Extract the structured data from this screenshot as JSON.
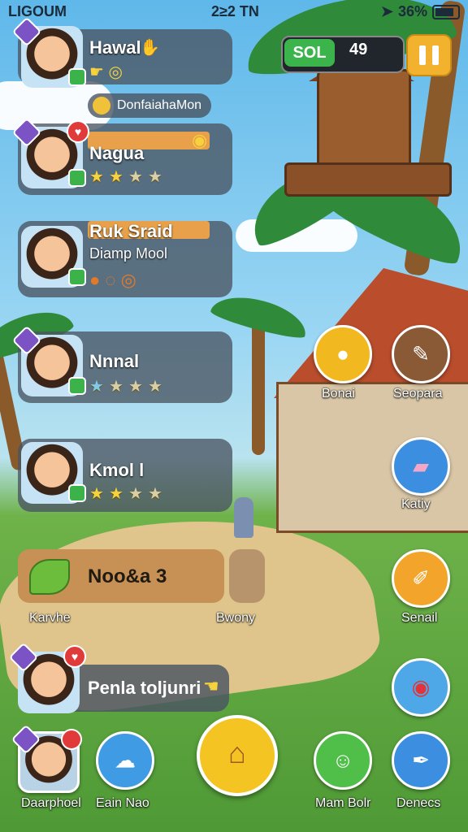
{
  "status_bar": {
    "carrier": "LIGOUM",
    "time": "2≥2 TN",
    "battery": "36%"
  },
  "hud": {
    "coin_label": "SOL",
    "coin_value": "49"
  },
  "chip": {
    "label": "DonfaiahaMon"
  },
  "friends": [
    {
      "name": "Hawal",
      "subtitle": "",
      "stars": []
    },
    {
      "name": "Nagua",
      "subtitle": "",
      "stars": [
        1,
        1,
        0,
        0
      ]
    },
    {
      "name": "Ruk Sraid",
      "subtitle": "Diamp Mool",
      "stars": []
    },
    {
      "name": "Nnnal",
      "subtitle": "",
      "stars": [
        1,
        0,
        0,
        0
      ]
    },
    {
      "name": "Kmol l",
      "subtitle": "",
      "stars": [
        1,
        1,
        0,
        0
      ]
    }
  ],
  "right_buttons": [
    {
      "label": "Bonai",
      "icon": "coin-icon"
    },
    {
      "label": "Seopara",
      "icon": "feather-icon"
    },
    {
      "label": "Katiy",
      "icon": "eraser-icon"
    },
    {
      "label": "Senail",
      "icon": "brush-icon"
    },
    {
      "label": "",
      "icon": "record-icon"
    },
    {
      "label": "Denecs",
      "icon": "pen-icon"
    }
  ],
  "bottom_card": {
    "title": "Noo&a 3"
  },
  "bottom_card_labels": {
    "left": "Karvhe",
    "right": "Bwony"
  },
  "message_card": {
    "text": "Penla toljunri"
  },
  "bottom_nav": [
    {
      "label": "Daarphoel"
    },
    {
      "label": "Eain Nao"
    },
    {
      "label": "Mam Bolr"
    }
  ],
  "colors": {
    "card_bg": "#4a5462",
    "accent_yellow": "#f4c422",
    "accent_green": "#3bb44c"
  }
}
